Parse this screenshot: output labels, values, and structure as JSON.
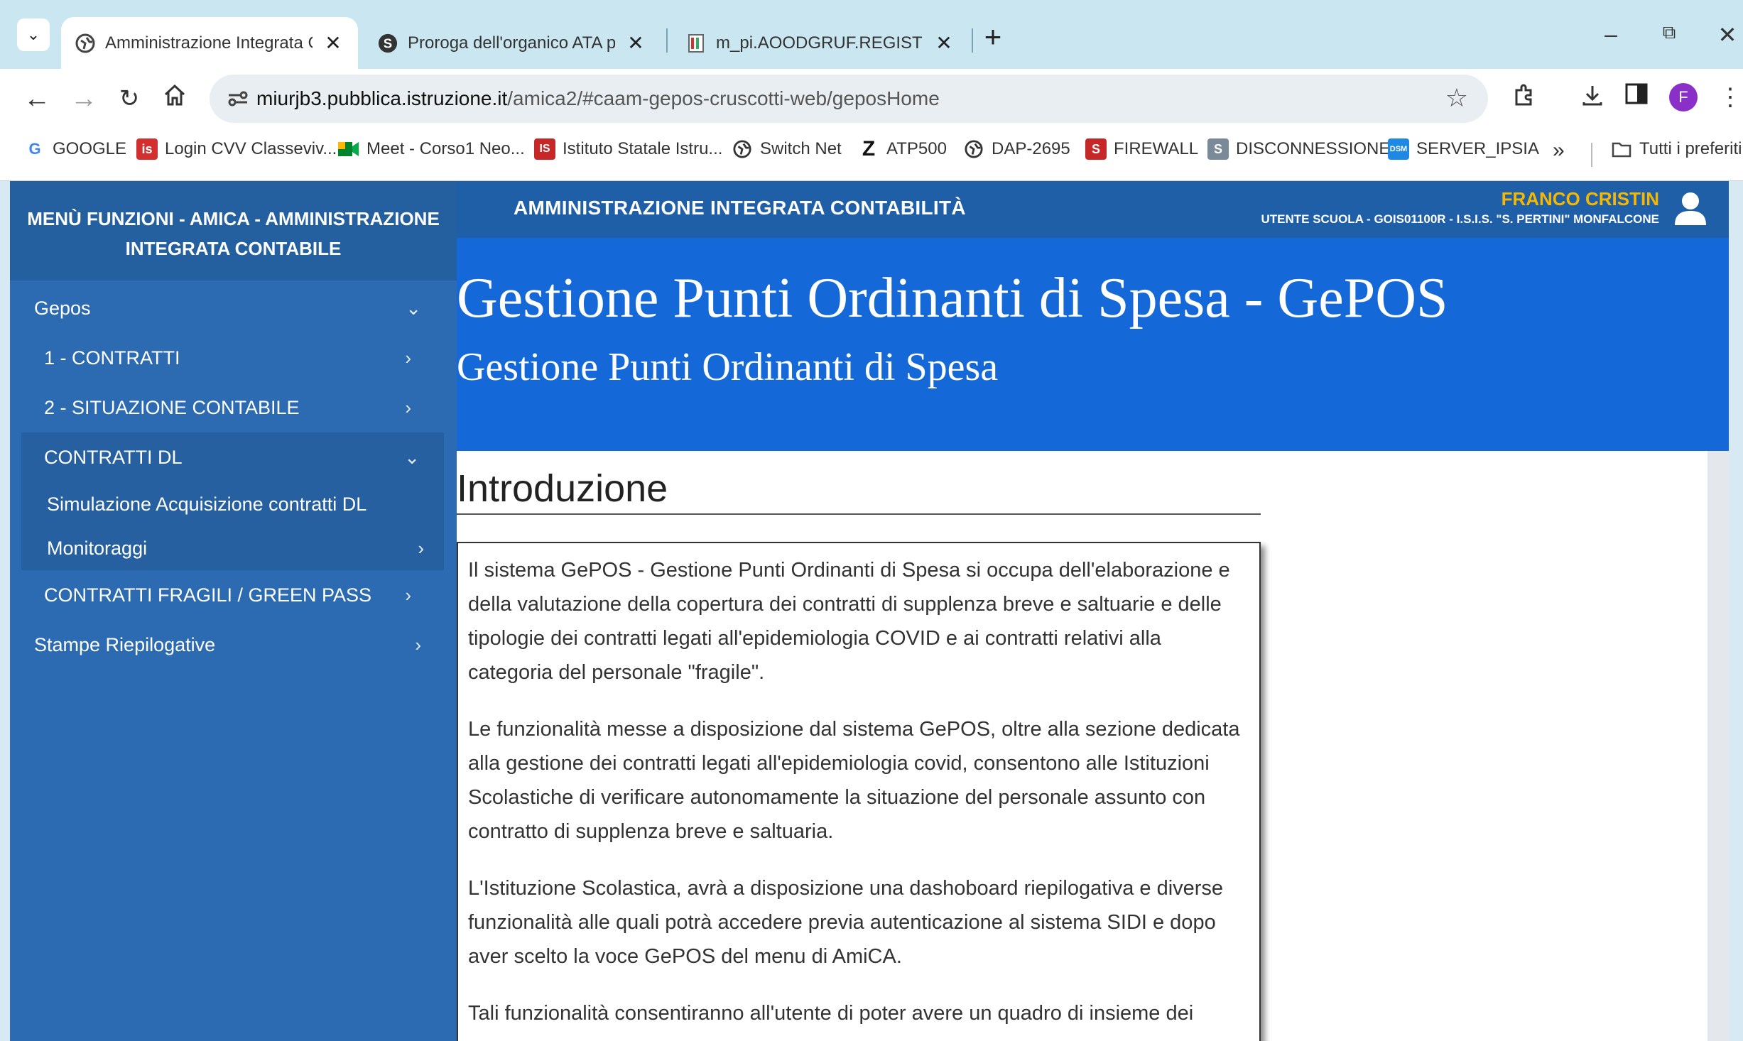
{
  "browser": {
    "tabs": [
      {
        "title": "Amministrazione Integrata Con",
        "active": true
      },
      {
        "title": "Proroga dell'organico ATA per F",
        "active": false
      },
      {
        "title": "m_pi.AOODGRUF.REGISTRO-UF",
        "active": false
      }
    ],
    "new_tab": "+",
    "window_controls": {
      "minimize": "–",
      "restore": "⧉",
      "close": "✕"
    },
    "url_host": "miurjb3.pubblica.istruzione.it",
    "url_path": "/amica2/#caam-gepos-cruscotti-web/geposHome",
    "profile_initial": "F",
    "bookmarks": [
      {
        "label": "GOOGLE",
        "icon": "google-icon"
      },
      {
        "label": "Login CVV Classeviv...",
        "icon": "classeviva-icon"
      },
      {
        "label": "Meet - Corso1 Neo...",
        "icon": "meet-icon"
      },
      {
        "label": "Istituto Statale Istru...",
        "icon": "school-icon"
      },
      {
        "label": "Switch Net",
        "icon": "globe-icon"
      },
      {
        "label": "ATP500",
        "icon": "z-icon"
      },
      {
        "label": "DAP-2695",
        "icon": "globe-icon"
      },
      {
        "label": "FIREWALL",
        "icon": "firewall-icon"
      },
      {
        "label": "DISCONNESSIONE",
        "icon": "disconnect-icon"
      },
      {
        "label": "SERVER_IPSIA",
        "icon": "server-icon"
      }
    ],
    "bookmarks_more": "»",
    "all_bookmarks": "Tutti i preferiti"
  },
  "sidebar": {
    "header": "MENÙ FUNZIONI - AMICA - AMMINISTRAZIONE INTEGRATA CONTABILE",
    "items": {
      "gepos": "Gepos",
      "contratti": "1 - CONTRATTI",
      "situazione": "2 - SITUAZIONE CONTABILE",
      "contratti_dl": "CONTRATTI DL",
      "simulazione": "Simulazione Acquisizione contratti DL",
      "monitoraggi": "Monitoraggi",
      "fragili": "CONTRATTI FRAGILI / GREEN PASS",
      "stampe": "Stampe Riepilogative"
    }
  },
  "header": {
    "title": "AMMINISTRAZIONE INTEGRATA CONTABILITÀ",
    "user_name": "FRANCO CRISTIN",
    "user_role": "UTENTE SCUOLA - GOIS01100R - I.S.I.S. \"S. PERTINI\" MONFALCONE"
  },
  "banner": {
    "title": "Gestione Punti Ordinanti di Spesa - GePOS",
    "subtitle": "Gestione Punti Ordinanti di Spesa"
  },
  "intro": {
    "title": "Introduzione",
    "paragraphs": [
      "Il sistema GePOS - Gestione Punti Ordinanti di Spesa si occupa dell'elaborazione e della valutazione della copertura dei contratti di supplenza breve e saltuarie e delle tipologie dei contratti legati all'epidemiologia COVID e ai contratti relativi alla categoria del personale \"fragile\".",
      "Le funzionalità messe a disposizione dal sistema GePOS, oltre alla sezione dedicata alla gestione dei contratti legati all'epidemiologia covid, consentono alle Istituzioni Scolastiche di verificare autonomamente la situazione del personale assunto con contratto di supplenza breve e saltuaria.",
      "L'Istituzione Scolastica, avrà a disposizione una dashoboard riepilogativa e diverse funzionalità alle quali potrà accedere previa autenticazione al sistema SIDI e dopo aver scelto la voce GePOS del menu di AmiCA.",
      "Tali funzionalità consentiranno all'utente di poter avere un quadro di insieme dei"
    ]
  },
  "colors": {
    "sidebar": "#2c6bb1",
    "header": "#1f5fa8",
    "banner": "#1468d8",
    "user_name": "#f5b800"
  }
}
